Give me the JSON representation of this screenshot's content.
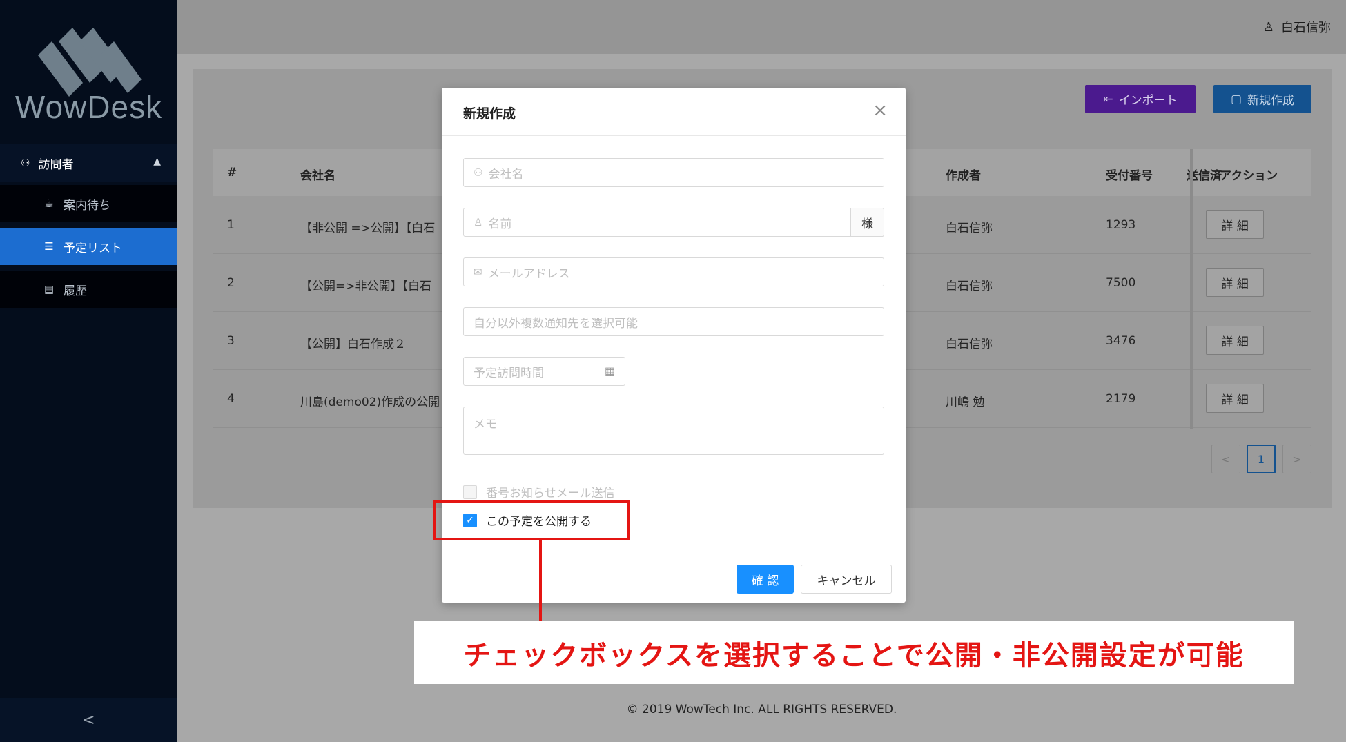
{
  "sidebar": {
    "logo_text": "WowDesk",
    "group_label": "訪問者",
    "items": [
      {
        "label": "案内待ち"
      },
      {
        "label": "予定リスト"
      },
      {
        "label": "履歴"
      }
    ],
    "collapse_glyph": "<"
  },
  "header": {
    "user_name": "白石信弥"
  },
  "toolbar": {
    "import_label": "インポート",
    "new_label": "新規作成"
  },
  "table": {
    "columns": [
      "#",
      "会社名",
      "作成者",
      "受付番号",
      "送信済",
      "アクション"
    ],
    "rows": [
      {
        "num": "1",
        "company": "【非公開 =>公開】【白石",
        "creator": "白石信弥",
        "reception": "1293",
        "action": "詳 細"
      },
      {
        "num": "2",
        "company": "【公開=>非公開】【白石",
        "creator": "白石信弥",
        "reception": "7500",
        "action": "詳 細"
      },
      {
        "num": "3",
        "company": "【公開】白石作成２",
        "creator": "白石信弥",
        "reception": "3476",
        "action": "詳 細"
      },
      {
        "num": "4",
        "company": "川島(demo02)作成の公開",
        "creator": "川嶋 勉",
        "reception": "2179",
        "action": "詳 細"
      }
    ]
  },
  "pagination": {
    "prev": "<",
    "current": "1",
    "next": ">"
  },
  "footer": {
    "copyright": "© 2019 WowTech Inc. ALL RIGHTS RESERVED."
  },
  "modal": {
    "title": "新規作成",
    "close_glyph": "×",
    "company_placeholder": "会社名",
    "name_placeholder": "名前",
    "name_suffix": "様",
    "email_placeholder": "メールアドレス",
    "notify_placeholder": "自分以外複数通知先を選択可能",
    "visit_time_placeholder": "予定訪問時間",
    "memo_placeholder": "メモ",
    "checkbox_mail_label": "番号お知らせメール送信",
    "checkbox_public_label": "この予定を公開する",
    "checkbox_public_checked": true,
    "ok_label": "確 認",
    "cancel_label": "キャンセル"
  },
  "annotation": {
    "callout_text": "チェックボックスを選択することで公開・非公開設定が可能"
  },
  "colors": {
    "primary": "#1890ff",
    "annotation_red": "#e41513",
    "sidebar_bg": "#040d1c",
    "active_nav": "#1c6dd0"
  }
}
